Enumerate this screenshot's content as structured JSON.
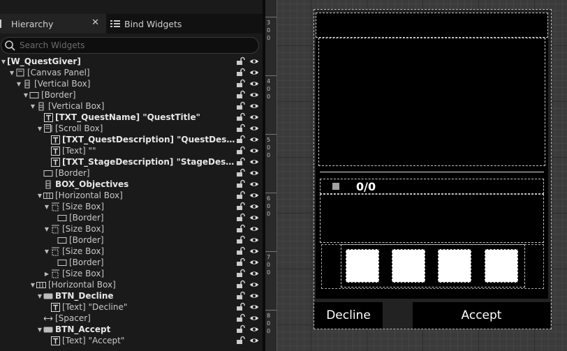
{
  "tabs": {
    "hierarchy": "Hierarchy",
    "bind_widgets": "Bind Widgets"
  },
  "search": {
    "placeholder": "Search Widgets"
  },
  "tree": [
    {
      "label": "[W_QuestGiver]",
      "bold": true,
      "icon": "none",
      "arrow": "down"
    },
    {
      "label": "[Canvas Panel]",
      "bold": false,
      "icon": "canvas-panel-icon",
      "arrow": "down"
    },
    {
      "label": "[Vertical Box]",
      "bold": false,
      "icon": "vertical-box-icon",
      "arrow": "down"
    },
    {
      "label": "[Border]",
      "bold": false,
      "icon": "border-icon",
      "arrow": "down"
    },
    {
      "label": "[Vertical Box]",
      "bold": false,
      "icon": "vertical-box-icon",
      "arrow": "down"
    },
    {
      "label": "[TXT_QuestName] \"QuestTitle\"",
      "bold": true,
      "icon": "text-icon",
      "arrow": "none"
    },
    {
      "label": "[Scroll Box]",
      "bold": false,
      "icon": "scroll-box-icon",
      "arrow": "down"
    },
    {
      "label": "[TXT_QuestDescription] \"QuestDescript..\"",
      "bold": true,
      "icon": "text-icon",
      "arrow": "none"
    },
    {
      "label": "[Text] \"\"",
      "bold": false,
      "icon": "text-icon",
      "arrow": "none"
    },
    {
      "label": "[TXT_StageDescription] \"StageDescript..\"",
      "bold": true,
      "icon": "text-icon",
      "arrow": "none"
    },
    {
      "label": "[Border]",
      "bold": false,
      "icon": "border-icon",
      "arrow": "none"
    },
    {
      "label": "BOX_Objectives",
      "bold": true,
      "icon": "vertical-box-icon",
      "arrow": "none"
    },
    {
      "label": "[Horizontal Box]",
      "bold": false,
      "icon": "horizontal-box-icon",
      "arrow": "down"
    },
    {
      "label": "[Size Box]",
      "bold": false,
      "icon": "size-box-icon",
      "arrow": "down"
    },
    {
      "label": "[Border]",
      "bold": false,
      "icon": "border-icon",
      "arrow": "none"
    },
    {
      "label": "[Size Box]",
      "bold": false,
      "icon": "size-box-icon",
      "arrow": "down"
    },
    {
      "label": "[Border]",
      "bold": false,
      "icon": "border-icon",
      "arrow": "none"
    },
    {
      "label": "[Size Box]",
      "bold": false,
      "icon": "size-box-icon",
      "arrow": "down"
    },
    {
      "label": "[Border]",
      "bold": false,
      "icon": "border-icon",
      "arrow": "none"
    },
    {
      "label": "[Size Box]",
      "bold": false,
      "icon": "size-box-icon",
      "arrow": "right"
    },
    {
      "label": "[Horizontal Box]",
      "bold": false,
      "icon": "horizontal-box-icon",
      "arrow": "down"
    },
    {
      "label": "BTN_Decline",
      "bold": true,
      "icon": "button-icon",
      "arrow": "down"
    },
    {
      "label": "[Text] \"Decline\"",
      "bold": false,
      "icon": "text-icon",
      "arrow": "none"
    },
    {
      "label": "[Spacer]",
      "bold": false,
      "icon": "spacer-icon",
      "arrow": "none"
    },
    {
      "label": "BTN_Accept",
      "bold": true,
      "icon": "button-icon",
      "arrow": "down"
    },
    {
      "label": "[Text] \"Accept\"",
      "bold": false,
      "icon": "text-icon",
      "arrow": "none"
    }
  ],
  "ruler_labels": [
    "300",
    "400",
    "500",
    "600",
    "700",
    "800"
  ],
  "preview": {
    "objective_counter": "0/0",
    "decline_label": "Decline",
    "accept_label": "Accept"
  }
}
